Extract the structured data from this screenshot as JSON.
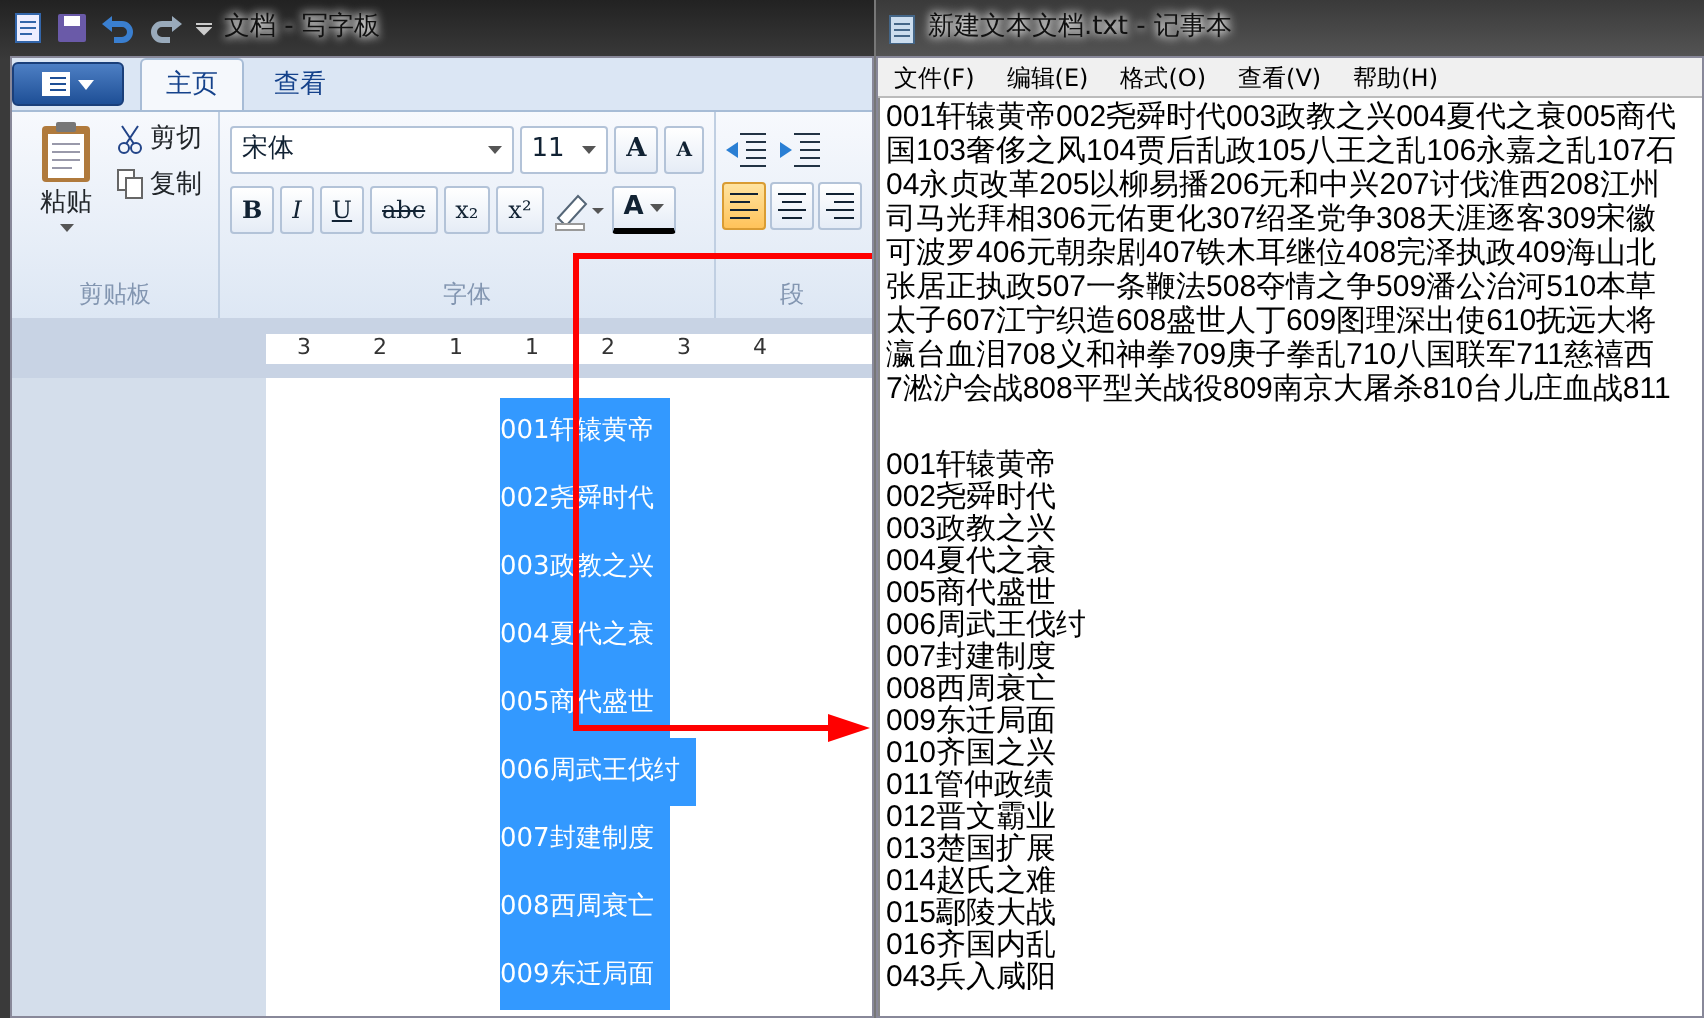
{
  "wordpad": {
    "title": "文档 - 写字板",
    "tabs": [
      {
        "label": "主页",
        "selected": true
      },
      {
        "label": "查看",
        "selected": false
      }
    ],
    "clipboard": {
      "paste": "粘贴",
      "cut": "剪切",
      "copy": "复制",
      "group_label": "剪贴板"
    },
    "font": {
      "family": "宋体",
      "size": "11",
      "grow": "A",
      "shrink": "A",
      "styles": [
        "B",
        "I",
        "U",
        "abc",
        "x₂",
        "x²"
      ],
      "color_button": "A",
      "group_label": "字体"
    },
    "paragraph": {
      "group_label": "段",
      "alignment": [
        {
          "selected": true
        },
        {
          "selected": false
        },
        {
          "selected": false
        }
      ]
    },
    "ruler": [
      "3",
      "2",
      "1",
      "1",
      "2",
      "3",
      "4"
    ],
    "document_lines": [
      {
        "text": "001轩辕黄帝",
        "selected": true
      },
      {
        "text": "002尧舜时代",
        "selected": true
      },
      {
        "text": "003政教之兴",
        "selected": true
      },
      {
        "text": "004夏代之衰",
        "selected": true
      },
      {
        "text": "005商代盛世",
        "selected": true
      },
      {
        "text": "006周武王伐纣",
        "selected": true
      },
      {
        "text": "007封建制度",
        "selected": true
      },
      {
        "text": "008西周衰亡",
        "selected": true
      },
      {
        "text": "009东迁局面",
        "selected": true
      }
    ]
  },
  "notepad": {
    "title": "新建文本文档.txt - 记事本",
    "menu": [
      "文件(F)",
      "编辑(E)",
      "格式(O)",
      "查看(V)",
      "帮助(H)"
    ],
    "paragraph_lines": [
      "001轩辕黄帝002尧舜时代003政教之兴004夏代之衰005商代",
      "国103奢侈之风104贾后乱政105八王之乱106永嘉之乱107石",
      "04永贞改革205以柳易播206元和中兴207讨伐淮西208江州",
      "司马光拜相306元佑更化307绍圣党争308天涯逐客309宋徽",
      "可波罗406元朝杂剧407铁木耳继位408完泽执政409海山北",
      "张居正执政507一条鞭法508夺情之争509潘公治河510本草",
      "太子607江宁织造608盛世人丁609图理深出使610抚远大将",
      "瀛台血泪708义和神拳709庚子拳乱710八国联军711慈禧西",
      "7淞沪会战808平型关战役809南京大屠杀810台儿庄血战811"
    ],
    "list_lines": [
      "001轩辕黄帝",
      "002尧舜时代",
      "003政教之兴",
      "004夏代之衰",
      "005商代盛世",
      "006周武王伐纣",
      "007封建制度",
      "008西周衰亡",
      "009东迁局面",
      "010齐国之兴",
      "011管仲政绩",
      "012晋文霸业",
      "013楚国扩展",
      "014赵氏之难",
      "015鄢陵大战",
      "016齐国内乱",
      "043兵入咸阳"
    ]
  }
}
